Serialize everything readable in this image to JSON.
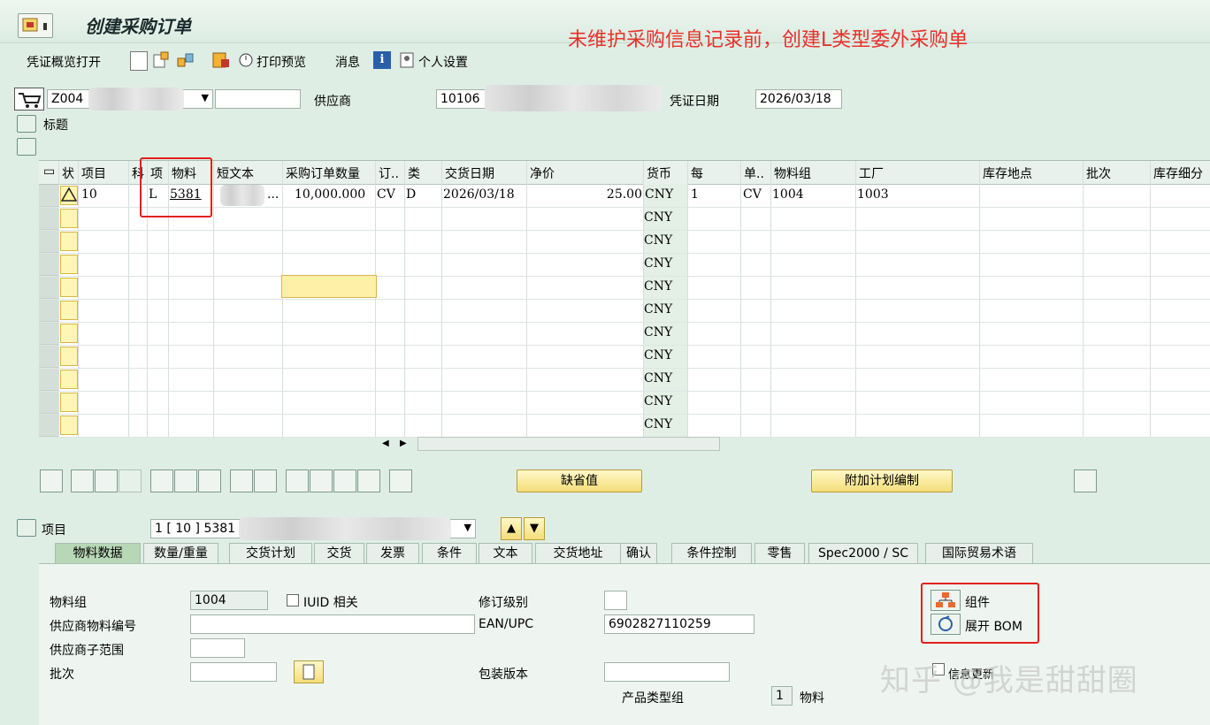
{
  "window": {
    "title": "创建采购订单"
  },
  "annotation": "未维护采购信息记录前，创建L类型委外采购单",
  "toolbar": {
    "doc_overview": "凭证概览打开",
    "print_preview": "打印预览",
    "messages": "消息",
    "personal_settings": "个人设置"
  },
  "header": {
    "order_type": "Z004",
    "vendor_label": "供应商",
    "vendor_value": "10106",
    "doc_date_label": "凭证日期",
    "doc_date_value": "2026/03/18",
    "title_label": "标题"
  },
  "grid": {
    "columns": [
      "状",
      "项目",
      "科",
      "项",
      "物料",
      "短文本",
      "采购订单数量",
      "订..",
      "类",
      "交货日期",
      "净价",
      "货币",
      "每",
      "单..",
      "物料组",
      "工厂",
      "库存地点",
      "批次",
      "库存细分"
    ],
    "row1": {
      "item": "10",
      "item_cat": "L",
      "material": "5381",
      "short_text": "...",
      "qty": "10,000.000",
      "unit": "CV",
      "type": "D",
      "delivery_date": "2026/03/18",
      "net_price": "25.00",
      "currency": "CNY",
      "per": "1",
      "order_unit": "CV",
      "material_group": "1004",
      "plant": "1003"
    },
    "empty_currency": "CNY"
  },
  "buttons": {
    "default_values": "缺省值",
    "additional_planning": "附加计划编制"
  },
  "item_section": {
    "label": "项目",
    "selector": "1 [ 10 ] 5381 ,"
  },
  "tabs": [
    "物料数据",
    "数量/重量",
    "交货计划",
    "交货",
    "发票",
    "条件",
    "文本",
    "交货地址",
    "确认",
    "条件控制",
    "零售",
    "Spec2000 / SC",
    "国际贸易术语"
  ],
  "material_data": {
    "material_group_label": "物料组",
    "material_group_value": "1004",
    "iuid_label": "IUID 相关",
    "vendor_material_label": "供应商物料编号",
    "vendor_subrange_label": "供应商子范围",
    "batch_label": "批次",
    "revision_label": "修订级别",
    "ean_label": "EAN/UPC",
    "ean_value": "6902827110259",
    "package_version_label": "包装版本",
    "product_type_group_label": "产品类型组",
    "product_type_group_value": "1",
    "product_type_group_text": "物料",
    "info_update_label": "信息更新",
    "components_label": "组件",
    "explode_bom_label": "展开 BOM"
  },
  "watermark": "知乎 @我是甜甜圈"
}
